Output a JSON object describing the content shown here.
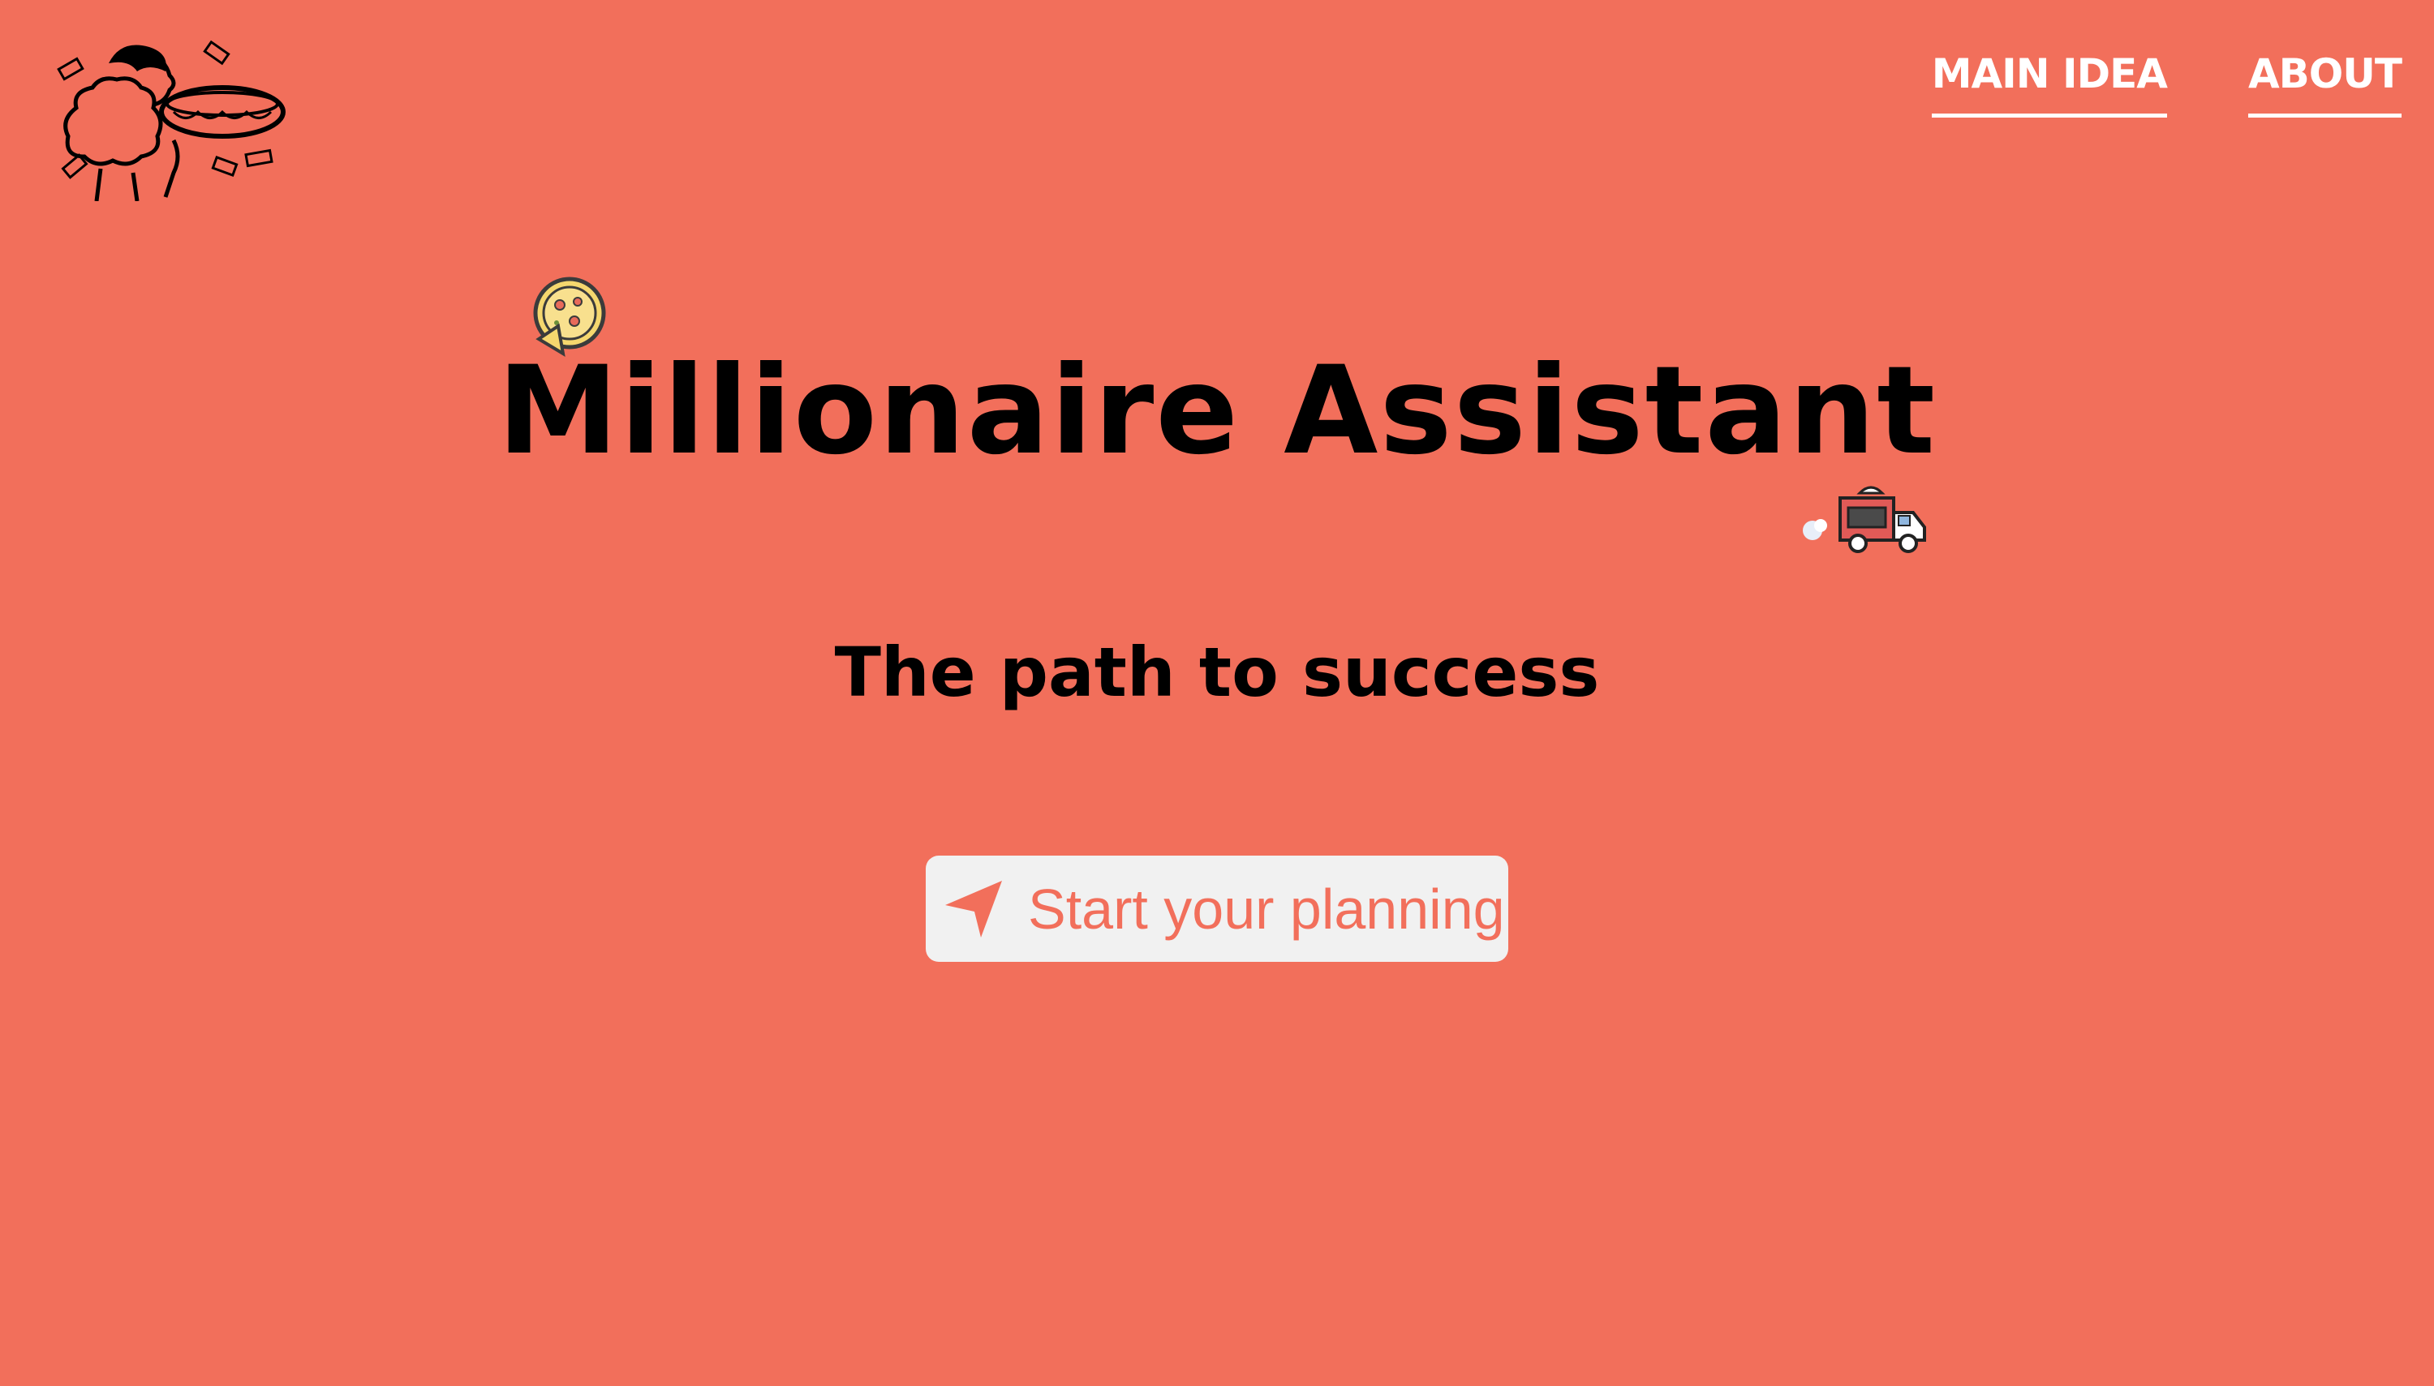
{
  "brand": {
    "logo_icon": "hotdog-eater-logo-icon"
  },
  "nav": {
    "items": [
      {
        "label": "MAIN IDEA"
      },
      {
        "label": "ABOUT"
      }
    ]
  },
  "hero": {
    "title": "Millionaire Assistant",
    "subtitle": "The path to success",
    "pizza_icon": "pizza-icon",
    "truck_icon": "food-truck-icon"
  },
  "cta": {
    "label": "Start your planning",
    "icon": "send-arrow-icon"
  },
  "colors": {
    "background": "#F26F5B",
    "nav_text": "#FFFFFF",
    "heading_text": "#000000",
    "button_bg": "#F1F1F1",
    "button_text": "#F26F5B"
  }
}
